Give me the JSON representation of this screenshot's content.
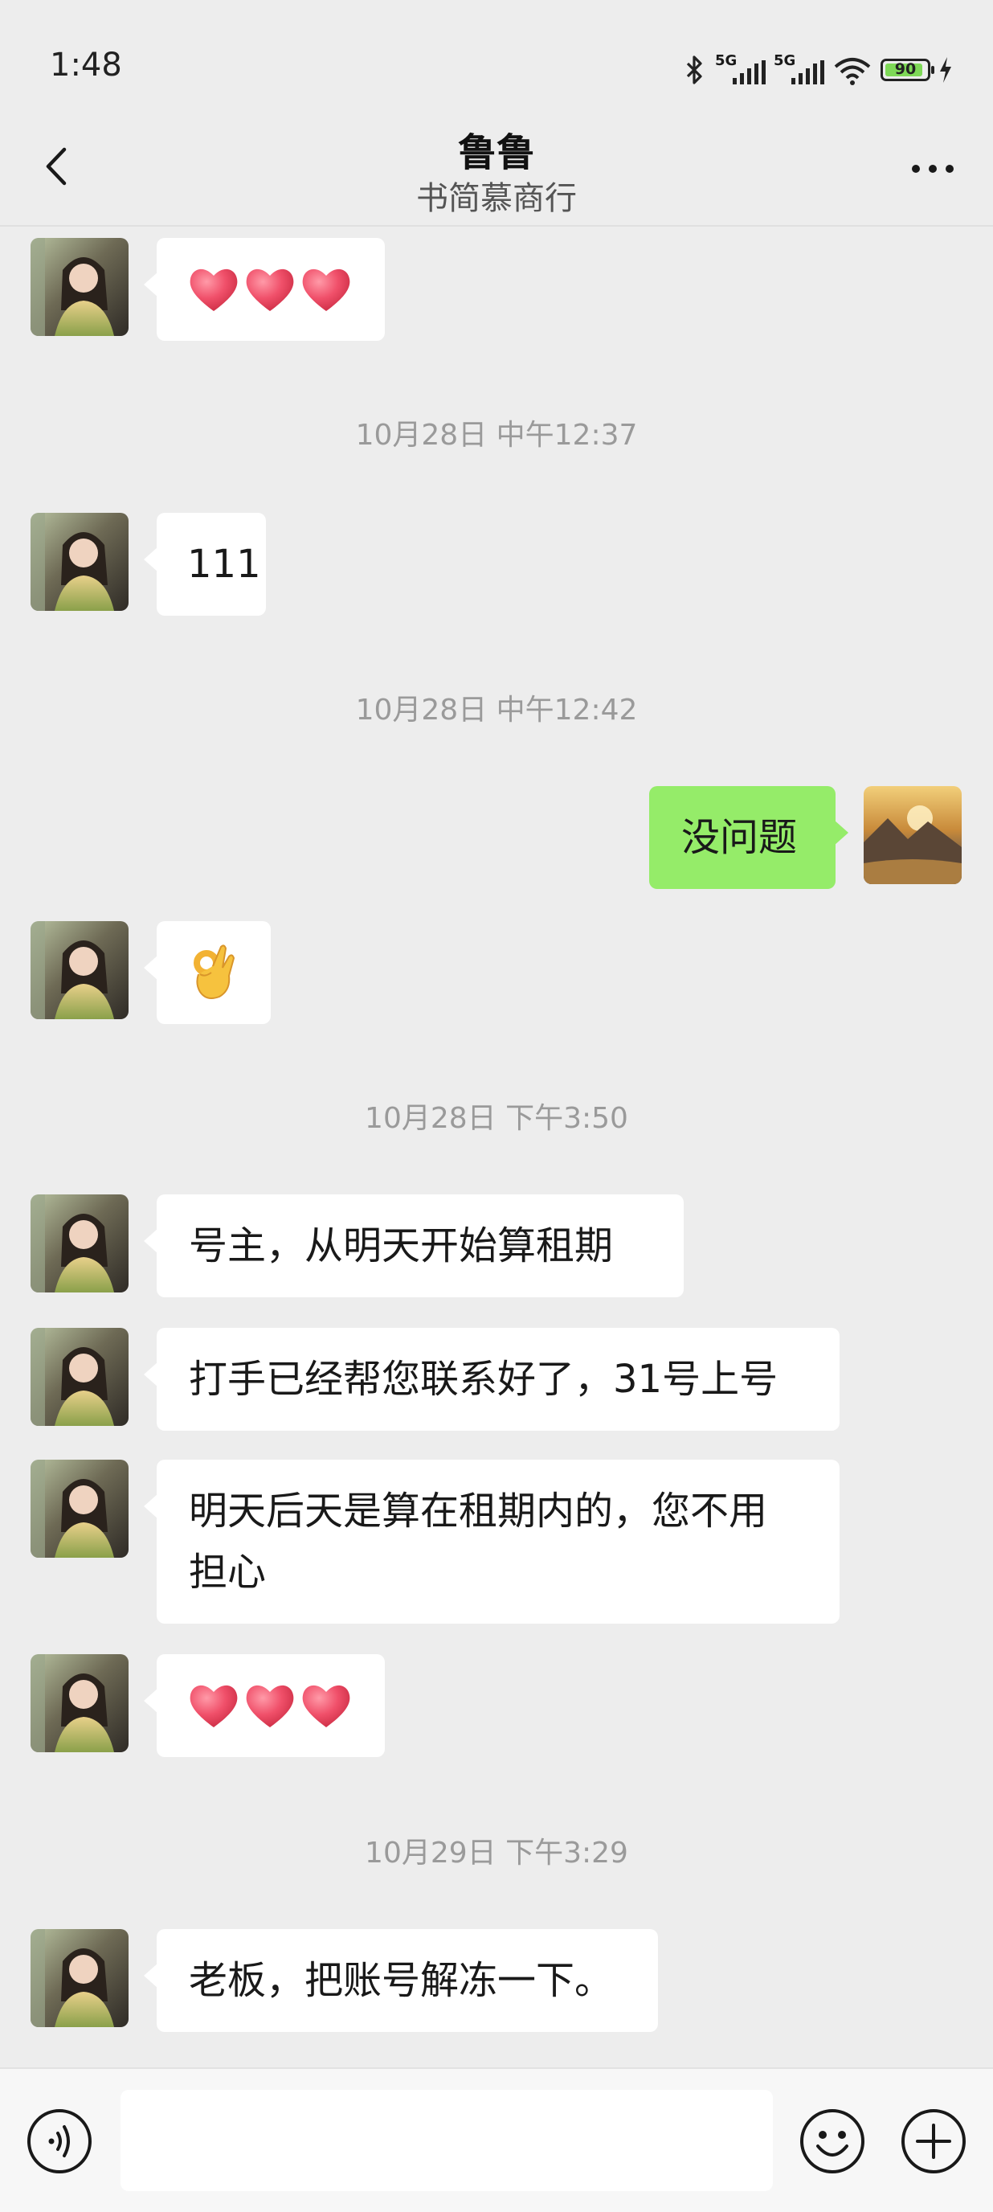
{
  "status_bar": {
    "time": "1:48",
    "network_1": "5G",
    "network_2": "5G",
    "battery": "90"
  },
  "header": {
    "title": "鲁鲁",
    "subtitle": "书简慕商行"
  },
  "messages": [
    {
      "type": "in",
      "emoji": "hearts",
      "count": 3
    },
    {
      "type": "time",
      "text": "10月28日 中午12:37"
    },
    {
      "type": "in",
      "text": "111"
    },
    {
      "type": "time",
      "text": "10月28日 中午12:42"
    },
    {
      "type": "out",
      "text": "没问题"
    },
    {
      "type": "in",
      "emoji": "ok-hand"
    },
    {
      "type": "time",
      "text": "10月28日 下午3:50"
    },
    {
      "type": "in",
      "text": "号主，从明天开始算租期"
    },
    {
      "type": "in",
      "text": "打手已经帮您联系好了，31号上号"
    },
    {
      "type": "in",
      "text": "明天后天是算在租期内的，您不用\n担心"
    },
    {
      "type": "in",
      "emoji": "hearts",
      "count": 3
    },
    {
      "type": "time",
      "text": "10月29日 下午3:29"
    },
    {
      "type": "in",
      "text": "老板，把账号解冻一下。"
    }
  ],
  "input": {
    "value": "",
    "placeholder": ""
  },
  "colors": {
    "background": "#ededed",
    "outgoing_bubble": "#95ec69",
    "incoming_bubble": "#ffffff",
    "timestamp": "#9a9a9a"
  },
  "icons": [
    "bluetooth-icon",
    "signal-icon",
    "wifi-icon",
    "battery-icon",
    "charging-icon",
    "back-icon",
    "more-icon",
    "voice-icon",
    "emoji-icon",
    "plus-icon",
    "heart-icon",
    "ok-hand-icon"
  ]
}
